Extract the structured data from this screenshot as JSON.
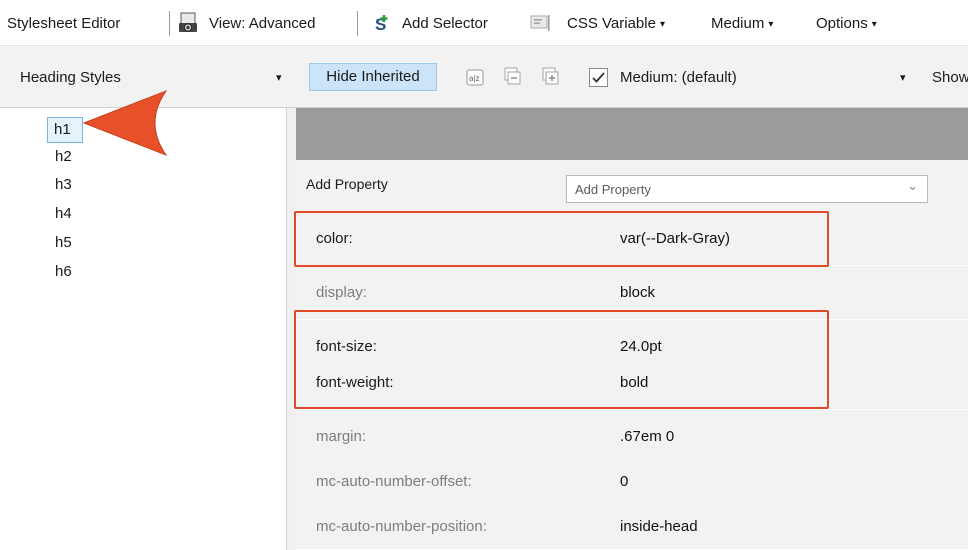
{
  "toolbar1": {
    "editor_label": "Stylesheet Editor",
    "view_label": "View: Advanced",
    "add_selector_label": "Add Selector",
    "css_variable_label": "CSS Variable",
    "medium_label": "Medium",
    "options_label": "Options",
    "caret": "▾"
  },
  "toolbar2": {
    "style_select_value": "Heading Styles",
    "hide_inherited_label": "Hide Inherited",
    "medium_select_value": "Medium: (default)",
    "show_label": "Show",
    "dropdown_glyph": "▾"
  },
  "tree": {
    "items": [
      "h1",
      "h2",
      "h3",
      "h4",
      "h5",
      "h6"
    ]
  },
  "grid": {
    "add_property_label": "Add Property",
    "add_property_placeholder": "Add Property",
    "add_property_chevron": "⌄",
    "properties": [
      {
        "name": "color:",
        "value": "var(--Dark-Gray)"
      },
      {
        "name": "display:",
        "value": "block"
      },
      {
        "name": "font-size:",
        "value": "24.0pt"
      },
      {
        "name": "font-weight:",
        "value": "bold"
      },
      {
        "name": "margin:",
        "value": ".67em 0"
      },
      {
        "name": "mc-auto-number-offset:",
        "value": "0"
      },
      {
        "name": "mc-auto-number-position:",
        "value": "inside-head"
      }
    ]
  },
  "colors": {
    "highlight": "#e0492a",
    "pointer_arrow": "#e8502a",
    "selection": "#cce4f7"
  },
  "icons": [
    "camera-icon",
    "add-selector-icon",
    "css-variable-icon",
    "sort-az-icon",
    "collapse-icon",
    "expand-icon",
    "checkbox-icon",
    "pointer-arrow-icon"
  ]
}
